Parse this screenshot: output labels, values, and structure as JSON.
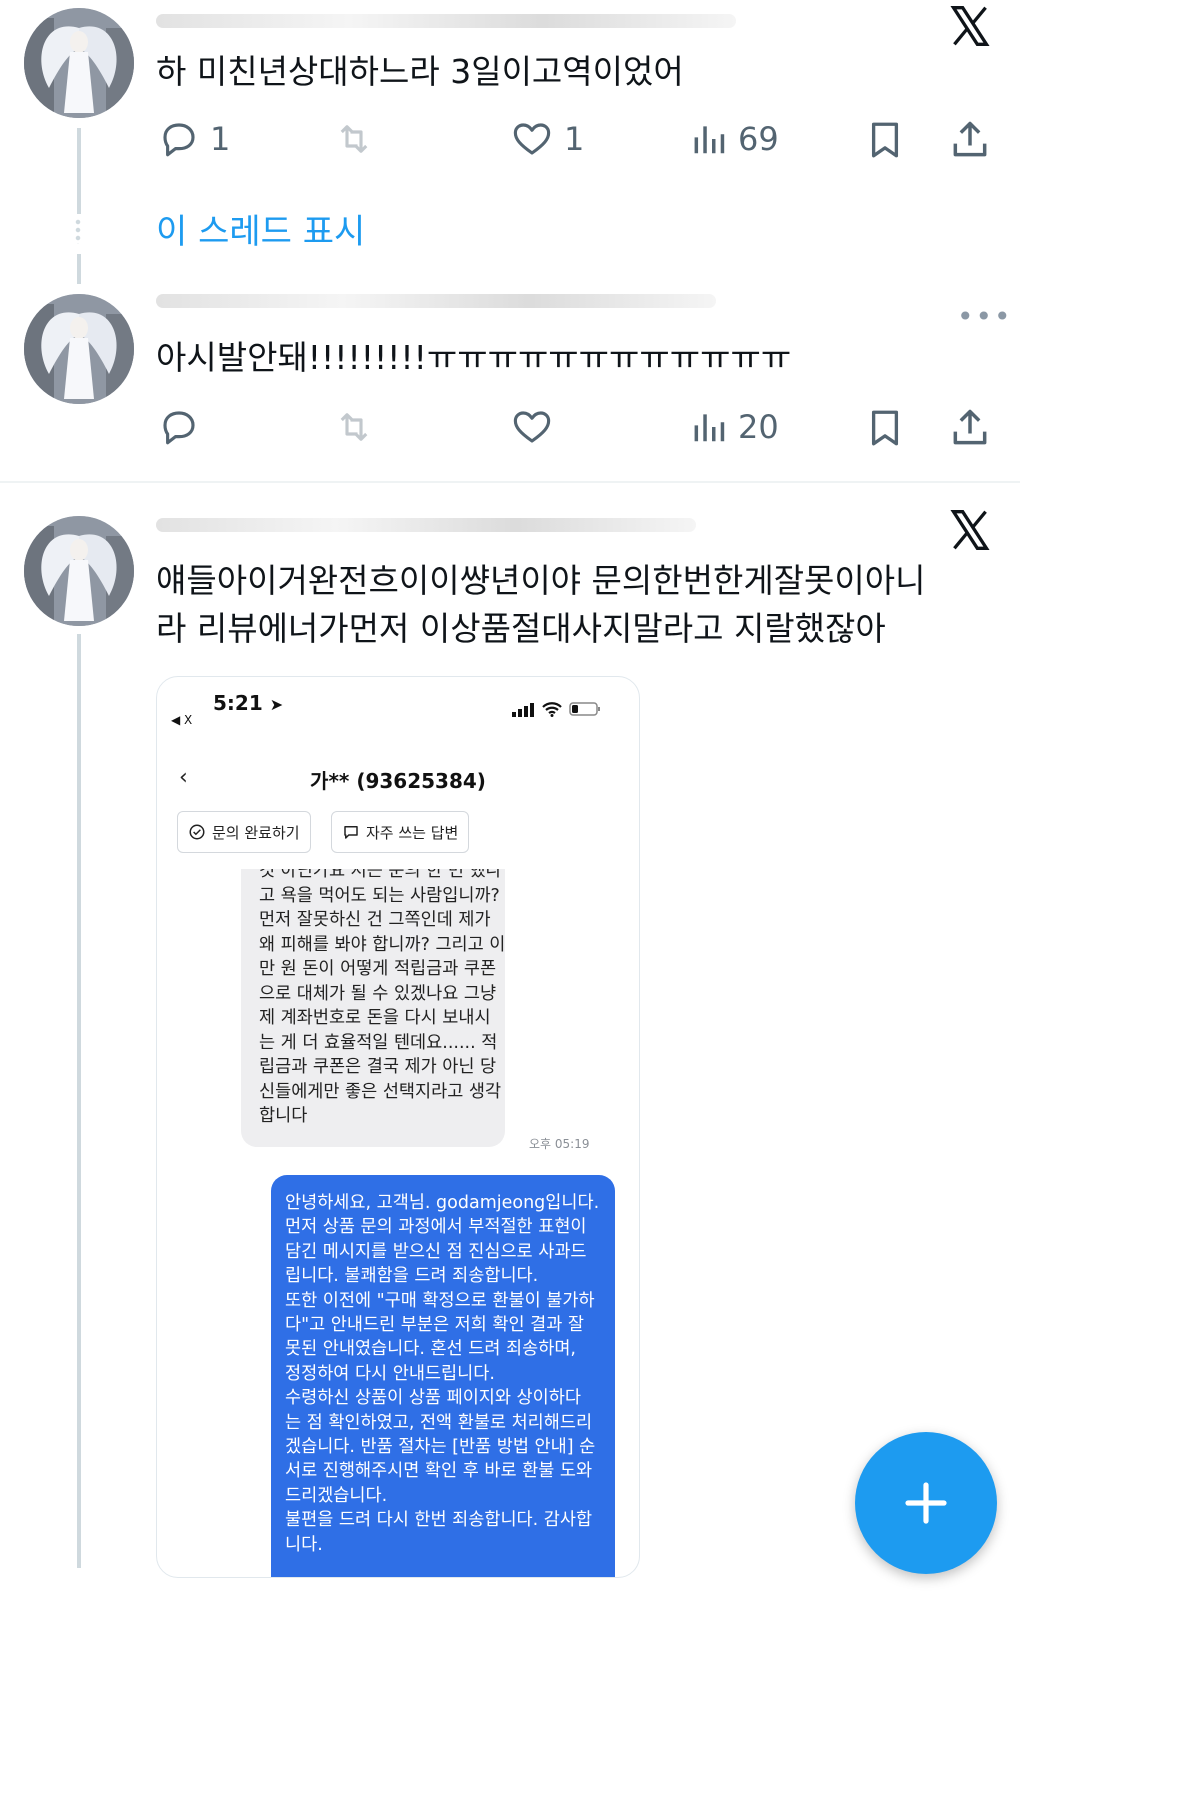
{
  "tweets": [
    {
      "author_blurred": "",
      "text": "하 미친년상대하느라 3일이고역이었어",
      "replies": "1",
      "retweets": "",
      "likes": "1",
      "views": "69"
    },
    {
      "author_blurred": "",
      "text": "아시발안돼!!!!!!!!!ㅠㅠㅠㅠㅠㅠㅠㅠㅠㅠㅠㅠ",
      "replies": "",
      "retweets": "",
      "likes": "",
      "views": "20"
    },
    {
      "author_blurred": "",
      "text_line1": "얘들아이거완전흐이이썅년이야 문의한번한게잘못이아니",
      "text_line2": "라 리뷰에너가먼저 이상품절대사지말라고 지랄했잖아"
    }
  ],
  "show_thread_label": "이 스레드 표시",
  "more_label": "•••",
  "embedded": {
    "status_time": "5:21",
    "back_app": "◀ X",
    "chat_title": "가** (93625384)",
    "chip_complete": "문의 완료하기",
    "chip_frequent": "자주 쓰는 답변",
    "incoming_lines": [
      "것 아닌가요 저는 문의 한 번 했나",
      "고 욕을 먹어도 되는 사람입니까?",
      "먼저 잘못하신 건 그쪽인데 제가",
      "왜 피해를 봐야 합니까? 그리고 이",
      "만 원 돈이 어떻게 적립금과 쿠폰",
      "으로 대체가 될 수 있겠나요 그냥",
      "제 계좌번호로 돈을 다시 보내시",
      "는 게 더 효율적일 텐데요...... 적",
      "립금과 쿠폰은 결국 제가 아닌 당",
      "신들에게만 좋은 선택지라고 생각",
      "합니다"
    ],
    "incoming_time": "오후 05:19",
    "outgoing_lines": [
      "안녕하세요, 고객님. godamjeong입니다.",
      "먼저 상품 문의 과정에서 부적절한 표현이",
      "담긴 메시지를 받으신 점 진심으로 사과드",
      "립니다. 불쾌함을 드려 죄송합니다.",
      "또한 이전에 \"구매 확정으로 환불이 불가하",
      "다\"고 안내드린 부분은 저희 확인 결과 잘",
      "못된 안내였습니다. 혼선 드려 죄송하며,",
      "정정하여 다시 안내드립니다.",
      "수령하신 상품이 상품 페이지와 상이하다",
      "는 점 확인하였고, 전액 환불로 처리해드리",
      "겠습니다. 반품 절차는 [반품 방법 안내] 순",
      "서로 진행해주시면 확인 후 바로 환불 도와",
      "드리겠습니다.",
      "불편을 드려 다시 한번 죄송합니다. 감사합",
      "니다."
    ],
    "outgoing_color": "#2f6fe6"
  },
  "colors": {
    "accent": "#1d9bf0",
    "muted": "#536471",
    "line": "#cfd9de"
  },
  "fab_icon": "plus-icon"
}
